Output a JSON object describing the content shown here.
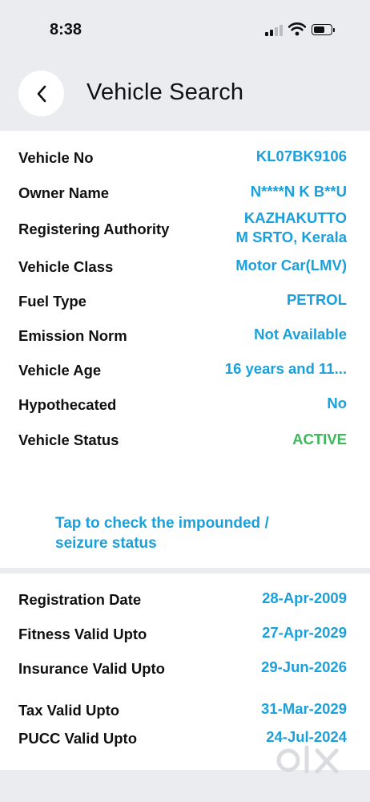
{
  "status_bar": {
    "time": "8:38"
  },
  "header": {
    "title": "Vehicle Search"
  },
  "vehicle_details": [
    {
      "label": "Vehicle No",
      "value": "KL07BK9106"
    },
    {
      "label": "Owner Name",
      "value": "N****N K B**U"
    },
    {
      "label": "Registering Authority",
      "value_line1": "KAZHAKUTTO",
      "value_line2": "M SRTO, Kerala"
    },
    {
      "label": "Vehicle Class",
      "value": "Motor Car(LMV)"
    },
    {
      "label": "Fuel Type",
      "value": "PETROL"
    },
    {
      "label": "Emission Norm",
      "value": "Not Available"
    },
    {
      "label": "Vehicle Age",
      "value": "16 years and 11..."
    },
    {
      "label": "Hypothecated",
      "value": "No"
    },
    {
      "label": "Vehicle Status",
      "value": "ACTIVE"
    }
  ],
  "impound_link": {
    "line1": "Tap to check the impounded /",
    "line2": "seizure status"
  },
  "validity_dates": [
    {
      "label": "Registration Date",
      "value": "28-Apr-2009"
    },
    {
      "label": "Fitness Valid Upto",
      "value": "27-Apr-2029"
    },
    {
      "label": "Insurance Valid Upto",
      "value": "29-Jun-2026"
    },
    {
      "label": "Tax Valid Upto",
      "value": "31-Mar-2029"
    },
    {
      "label": "PUCC Valid Upto",
      "value": "24-Jul-2024"
    }
  ],
  "colors": {
    "accent": "#1ba0dc",
    "status_active": "#3bb85a",
    "background": "#eaecf0"
  },
  "watermark": {
    "text": "olx"
  }
}
